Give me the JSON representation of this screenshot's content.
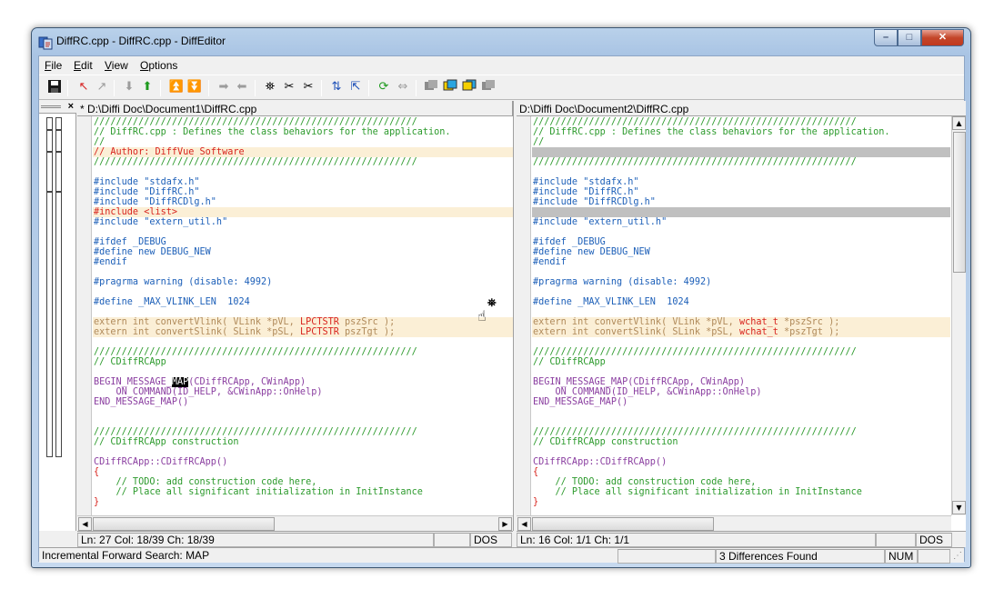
{
  "window": {
    "title": "DiffRC.cpp - DiffRC.cpp - DiffEditor",
    "buttons": {
      "minimize": "–",
      "maximize": "□",
      "close": "✕"
    }
  },
  "menu": [
    "File",
    "Edit",
    "View",
    "Options"
  ],
  "toolbar_icons": [
    "save-icon",
    "first-diff-icon",
    "last-diff-icon",
    "next-diff-down-icon",
    "prev-diff-up-icon",
    "first-change-up-icon",
    "last-change-down-icon",
    "copy-right-icon",
    "copy-left-icon",
    "find-icon",
    "find-next-icon",
    "find-prev-icon",
    "swap-icon",
    "goto-icon",
    "refresh-icon",
    "sync-icon",
    "view-1-icon",
    "view-2-icon",
    "view-3-icon",
    "view-4-icon"
  ],
  "diffmap": {
    "close": "×"
  },
  "left": {
    "path": "* D:\\Diffi Doc\\Document1\\DiffRC.cpp",
    "status": {
      "pos": "Ln: 27  Col: 18/39  Ch: 18/39",
      "mode": "DOS"
    }
  },
  "right": {
    "path": "D:\\Diffi Doc\\Document2\\DiffRC.cpp",
    "status": {
      "pos": "Ln: 16  Col: 1/1  Ch: 1/1",
      "mode": "DOS"
    }
  },
  "status": {
    "message": "Incremental Forward Search: MAP",
    "diffs": "3 Differences Found",
    "num": "NUM"
  },
  "code_left": [
    {
      "t": "c",
      "s": "//////////////////////////////////////////////////////////"
    },
    {
      "t": "c",
      "s": "// DiffRC.cpp : Defines the class behaviors for the application."
    },
    {
      "t": "c",
      "s": "//"
    },
    {
      "t": "r",
      "s": "// Author: DiffVue Software",
      "hl": true
    },
    {
      "t": "c",
      "s": "//////////////////////////////////////////////////////////"
    },
    {
      "t": "",
      "s": ""
    },
    {
      "t": "p",
      "s": "#include \"stdafx.h\""
    },
    {
      "t": "p",
      "s": "#include \"DiffRC.h\""
    },
    {
      "t": "p",
      "s": "#include \"DiffRCDlg.h\""
    },
    {
      "t": "r",
      "s": "#include <list>",
      "hl": true
    },
    {
      "t": "p",
      "s": "#include \"extern_util.h\""
    },
    {
      "t": "",
      "s": ""
    },
    {
      "t": "p",
      "s": "#ifdef _DEBUG"
    },
    {
      "t": "p",
      "s": "#define new DEBUG_NEW"
    },
    {
      "t": "p",
      "s": "#endif"
    },
    {
      "t": "",
      "s": ""
    },
    {
      "t": "p",
      "s": "#pragrma warning (disable: 4992)"
    },
    {
      "t": "",
      "s": ""
    },
    {
      "t": "p",
      "s": "#define _MAX_VLINK_LEN  1024"
    },
    {
      "t": "",
      "s": ""
    },
    {
      "t": "ext",
      "s": "extern int convertVlink( VLink *pVL, ",
      "red": "LPCTSTR",
      "tail": " pszSrc );",
      "hl": true
    },
    {
      "t": "ext",
      "s": "extern int convertSlink( SLink *pSL, ",
      "red": "LPCTSTR",
      "tail": " pszTgt );",
      "hl": true
    },
    {
      "t": "",
      "s": ""
    },
    {
      "t": "c",
      "s": "//////////////////////////////////////////////////////////"
    },
    {
      "t": "c",
      "s": "// CDiffRCApp"
    },
    {
      "t": "",
      "s": ""
    },
    {
      "t": "sel",
      "a": "BEGIN_MESSAGE_",
      "b": "MAP",
      "c": "(CDiffRCApp, CWinApp)"
    },
    {
      "t": "on",
      "s": "    ON_COMMAND(ID_HELP, &CWinApp::OnHelp)"
    },
    {
      "t": "m",
      "s": "END_MESSAGE_MAP()"
    },
    {
      "t": "",
      "s": ""
    },
    {
      "t": "",
      "s": ""
    },
    {
      "t": "c",
      "s": "//////////////////////////////////////////////////////////"
    },
    {
      "t": "c",
      "s": "// CDiffRCApp construction"
    },
    {
      "t": "",
      "s": ""
    },
    {
      "t": "ctor",
      "s": "CDiffRCApp::CDiffRCApp()"
    },
    {
      "t": "r",
      "s": "{"
    },
    {
      "t": "c",
      "s": "    // TODO: add construction code here,"
    },
    {
      "t": "c",
      "s": "    // Place all significant initialization in InitInstance"
    },
    {
      "t": "r",
      "s": "}"
    }
  ],
  "code_right": [
    {
      "t": "c",
      "s": "//////////////////////////////////////////////////////////"
    },
    {
      "t": "c",
      "s": "// DiffRC.cpp : Defines the class behaviors for the application."
    },
    {
      "t": "c",
      "s": "//"
    },
    {
      "t": "",
      "s": "",
      "gr": true
    },
    {
      "t": "c",
      "s": "//////////////////////////////////////////////////////////"
    },
    {
      "t": "",
      "s": ""
    },
    {
      "t": "p",
      "s": "#include \"stdafx.h\""
    },
    {
      "t": "p",
      "s": "#include \"DiffRC.h\""
    },
    {
      "t": "p",
      "s": "#include \"DiffRCDlg.h\""
    },
    {
      "t": "",
      "s": "",
      "gr": true
    },
    {
      "t": "p",
      "s": "#include \"extern_util.h\""
    },
    {
      "t": "",
      "s": ""
    },
    {
      "t": "p",
      "s": "#ifdef _DEBUG"
    },
    {
      "t": "p",
      "s": "#define new DEBUG_NEW"
    },
    {
      "t": "p",
      "s": "#endif"
    },
    {
      "t": "",
      "s": ""
    },
    {
      "t": "p",
      "s": "#pragrma warning (disable: 4992)"
    },
    {
      "t": "",
      "s": ""
    },
    {
      "t": "p",
      "s": "#define _MAX_VLINK_LEN  1024"
    },
    {
      "t": "",
      "s": ""
    },
    {
      "t": "ext",
      "s": "extern int convertVlink( VLink *pVL, ",
      "red": "wchat_t",
      "tail": " *pszSrc );",
      "hl": true
    },
    {
      "t": "ext",
      "s": "extern int convertSlink( SLink *pSL, ",
      "red": "wchat_t",
      "tail": " *pszTgt );",
      "hl": true
    },
    {
      "t": "",
      "s": ""
    },
    {
      "t": "c",
      "s": "//////////////////////////////////////////////////////////"
    },
    {
      "t": "c",
      "s": "// CDiffRCApp"
    },
    {
      "t": "",
      "s": ""
    },
    {
      "t": "m",
      "s": "BEGIN_MESSAGE_MAP(CDiffRCApp, CWinApp)"
    },
    {
      "t": "on",
      "s": "    ON_COMMAND(ID_HELP, &CWinApp::OnHelp)"
    },
    {
      "t": "m",
      "s": "END_MESSAGE_MAP()"
    },
    {
      "t": "",
      "s": ""
    },
    {
      "t": "",
      "s": ""
    },
    {
      "t": "c",
      "s": "//////////////////////////////////////////////////////////"
    },
    {
      "t": "c",
      "s": "// CDiffRCApp construction"
    },
    {
      "t": "",
      "s": ""
    },
    {
      "t": "ctor",
      "s": "CDiffRCApp::CDiffRCApp()"
    },
    {
      "t": "r",
      "s": "{"
    },
    {
      "t": "c",
      "s": "    // TODO: add construction code here,"
    },
    {
      "t": "c",
      "s": "    // Place all significant initialization in InitInstance"
    },
    {
      "t": "r",
      "s": "}"
    }
  ]
}
